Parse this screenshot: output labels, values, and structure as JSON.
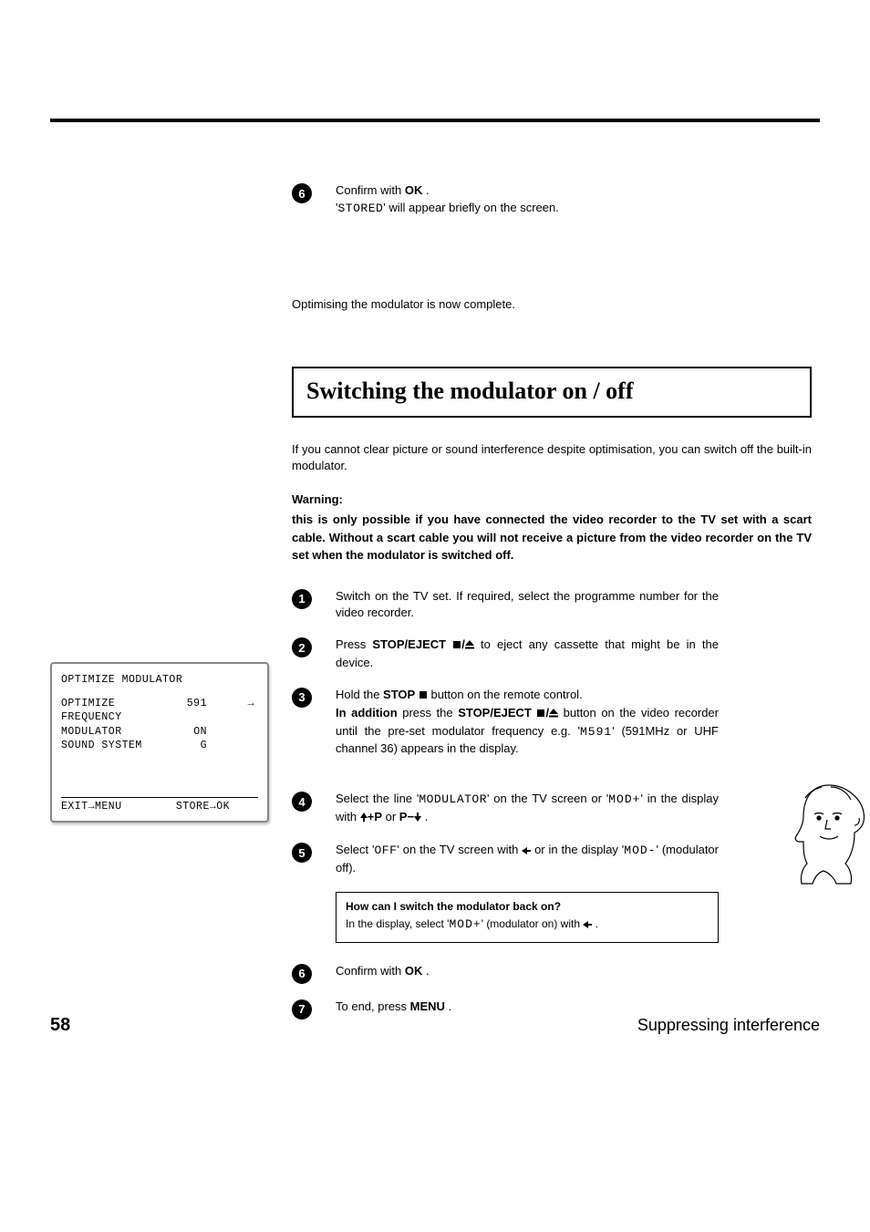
{
  "top_step6": {
    "num": "6",
    "line1_pre": "Confirm with ",
    "line1_key": "OK",
    "line1_post": " .",
    "line2_pre": "'",
    "line2_mono": "STORED",
    "line2_post": "' will appear briefly on the screen."
  },
  "complete_para": "Optimising the modulator is now complete.",
  "section_title": "Switching the modulator on / off",
  "intro_para": "If you cannot clear picture or sound interference despite optimisation, you can switch off the built-in modulator.",
  "warning_label": "Warning:",
  "warning_para": "this is only possible if you have connected the video recorder to the TV set with a scart cable. Without a scart cable you will not receive a picture from the video recorder on the TV set when the modulator is switched off.",
  "steps": {
    "s1": {
      "num": "1",
      "text": "Switch on the TV set. If required, select the programme number for the video recorder."
    },
    "s2": {
      "num": "2",
      "pre": "Press ",
      "key": "STOP/EJECT",
      "post": " to eject any cassette that might be in the device."
    },
    "s3": {
      "num": "3",
      "a_pre": "Hold the ",
      "a_key": "STOP",
      "a_post": " button on the remote control.",
      "b_pre": "In addition",
      "b_mid": " press the ",
      "b_key": "STOP/EJECT",
      "b_post": " button on the video recorder until the pre-set modulator frequency e.g. '",
      "b_seg": "M591",
      "b_tail": "' (591MHz or UHF channel 36) appears in the display."
    },
    "s4": {
      "num": "4",
      "pre": "Select the line '",
      "mono": "MODULATOR",
      "mid": "' on the TV screen or '",
      "seg": "MOD+",
      "mid2": "' in the display with ",
      "key1": "P",
      "or": " or ",
      "key2": "P",
      "post": " ."
    },
    "s5": {
      "num": "5",
      "pre": "Select '",
      "mono": "OFF",
      "mid": "' on the TV screen with ",
      "mid2": " or in the display '",
      "seg": "MOD-",
      "post": "' (modulator off)."
    },
    "s6": {
      "num": "6",
      "pre": "Confirm with ",
      "key": "OK",
      "post": " ."
    },
    "s7": {
      "num": "7",
      "pre": "To end, press ",
      "key": "MENU",
      "post": " ."
    }
  },
  "note": {
    "title": "How can I switch the modulator back on?",
    "pre": "In the display, select '",
    "seg": "MOD+",
    "mid": "' (modulator on) with ",
    "post": " ."
  },
  "tv": {
    "title": "OPTIMIZE MODULATOR",
    "rows": [
      {
        "label": "OPTIMIZE FREQUENCY",
        "val": "591",
        "arrow": "→"
      },
      {
        "label": "MODULATOR",
        "val": "ON",
        "arrow": ""
      },
      {
        "label": "SOUND SYSTEM",
        "val": "G",
        "arrow": ""
      }
    ],
    "footer_left": "EXIT→MENU",
    "footer_right": "STORE→OK"
  },
  "footer": {
    "page": "58",
    "chapter": "Suppressing interference"
  }
}
